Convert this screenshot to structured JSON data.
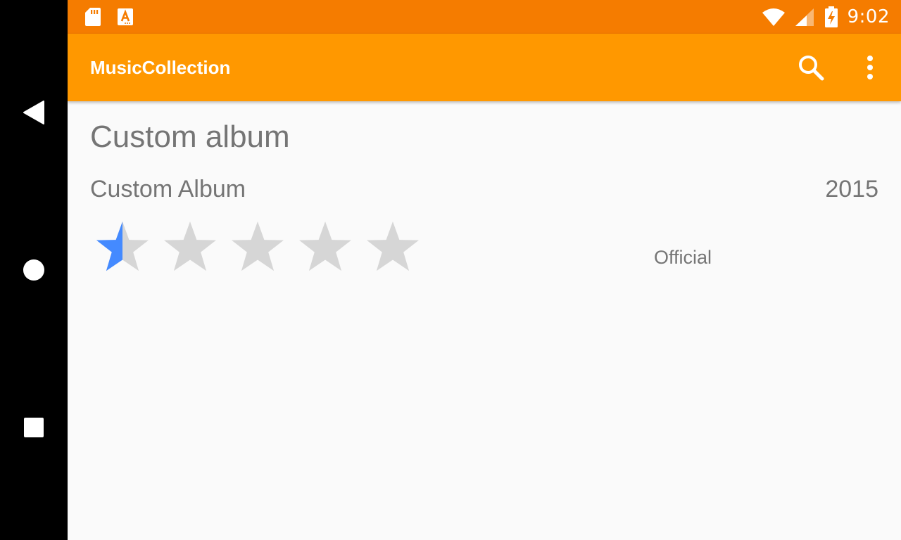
{
  "status_bar": {
    "time": "9:02",
    "icons": [
      "sd-card-icon",
      "font-download-icon",
      "wifi-icon",
      "signal-icon",
      "battery-charging-icon"
    ]
  },
  "app_bar": {
    "title": "MusicCollection",
    "actions": [
      "search-icon",
      "more-vert-icon"
    ]
  },
  "album": {
    "heading": "Custom album",
    "name": "Custom Album",
    "year": "2015",
    "rating": 0.5,
    "max_rating": 5,
    "status": "Official"
  },
  "colors": {
    "status_bar": "#F57C00",
    "app_bar": "#FF9800",
    "star_filled": "#448AFF",
    "star_empty": "#D6D6D6",
    "text": "#757575",
    "background": "#FAFAFA"
  },
  "nav_bar": {
    "buttons": [
      "back-icon",
      "home-icon",
      "recents-icon"
    ]
  }
}
